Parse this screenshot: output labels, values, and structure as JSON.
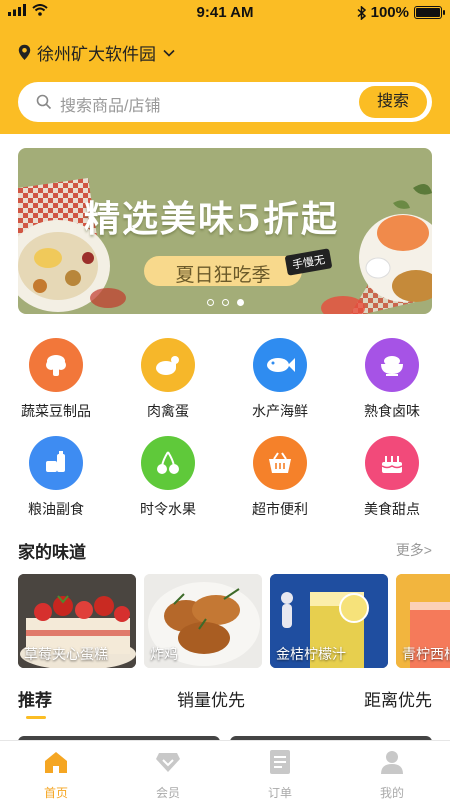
{
  "status": {
    "time": "9:41 AM",
    "battery": "100%",
    "battery_level": 1.0
  },
  "header": {
    "location": "徐州矿大软件园"
  },
  "search": {
    "placeholder": "搜索商品/店铺",
    "button": "搜索"
  },
  "banner": {
    "title": "精选美味5折起",
    "subtitle": "夏日狂吃季",
    "tag": "手慢无",
    "slides": 3,
    "active_slide": 3
  },
  "categories": [
    {
      "label": "蔬菜豆制品",
      "icon": "vegetable-icon",
      "color": "#f2773a"
    },
    {
      "label": "肉禽蛋",
      "icon": "chicken-icon",
      "color": "#f6b72a"
    },
    {
      "label": "水产海鲜",
      "icon": "fish-icon",
      "color": "#2f8cf0"
    },
    {
      "label": "熟食卤味",
      "icon": "bowl-icon",
      "color": "#a653e6"
    },
    {
      "label": "粮油副食",
      "icon": "oil-icon",
      "color": "#3e8cf2"
    },
    {
      "label": "时令水果",
      "icon": "cherry-icon",
      "color": "#5fc93a"
    },
    {
      "label": "超市便利",
      "icon": "basket-icon",
      "color": "#f5812a"
    },
    {
      "label": "美食甜点",
      "icon": "cake-icon",
      "color": "#f24a7a"
    }
  ],
  "section": {
    "title": "家的味道",
    "more": "更多>"
  },
  "cards": [
    {
      "label": "草莓夹心蛋糕"
    },
    {
      "label": "炸鸡"
    },
    {
      "label": "金桔柠檬汁"
    },
    {
      "label": "青柠西柚"
    }
  ],
  "tabs": [
    {
      "label": "推荐",
      "active": true
    },
    {
      "label": "销量优先",
      "active": false
    },
    {
      "label": "距离优先",
      "active": false
    }
  ],
  "tabbar": [
    {
      "label": "首页",
      "icon": "home-icon",
      "active": true
    },
    {
      "label": "会员",
      "icon": "diamond-icon",
      "active": false
    },
    {
      "label": "订单",
      "icon": "order-icon",
      "active": false
    },
    {
      "label": "我的",
      "icon": "profile-icon",
      "active": false
    }
  ],
  "colors": {
    "accent": "#fbbd24",
    "active_tab": "#f5a623",
    "inactive": "#aaaaaa"
  }
}
